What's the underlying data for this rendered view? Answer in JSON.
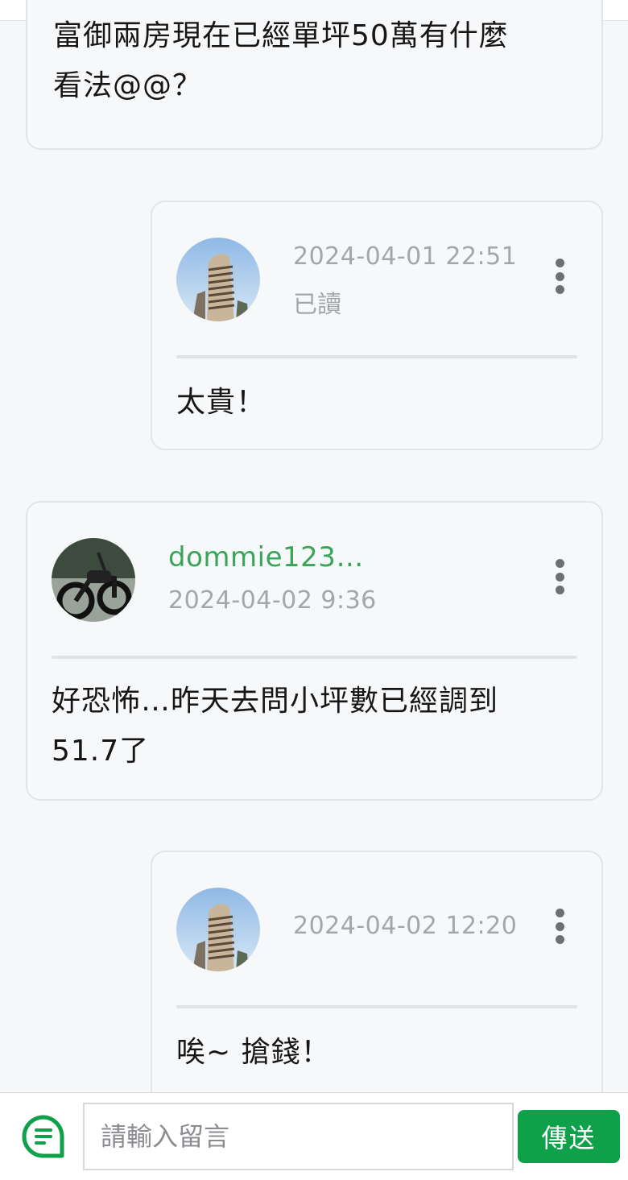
{
  "thread": {
    "first_post": {
      "text_line1": "富御兩房現在已經單坪50萬有什麼",
      "text_line2": "看法@@？"
    },
    "reply1": {
      "timestamp": "2024-04-01 22:51",
      "read_status": "已讀",
      "text": "太貴！"
    },
    "post2": {
      "username": "dommie123…",
      "timestamp": "2024-04-02 9:36",
      "text_line1": "好恐怖…昨天去問小坪數已經調到",
      "text_line2": "51.7了"
    },
    "reply2": {
      "timestamp": "2024-04-02 12:20",
      "text": "唉~ 搶錢！"
    }
  },
  "composer": {
    "placeholder": "請輸入留言",
    "send_label": "傳送"
  },
  "colors": {
    "accent_green": "#0fa04a",
    "username_green": "#3aa55a",
    "meta_gray": "#a3a6ab"
  },
  "icons": {
    "menu": "more-vertical-icon",
    "composer": "chat-bubble-icon"
  }
}
